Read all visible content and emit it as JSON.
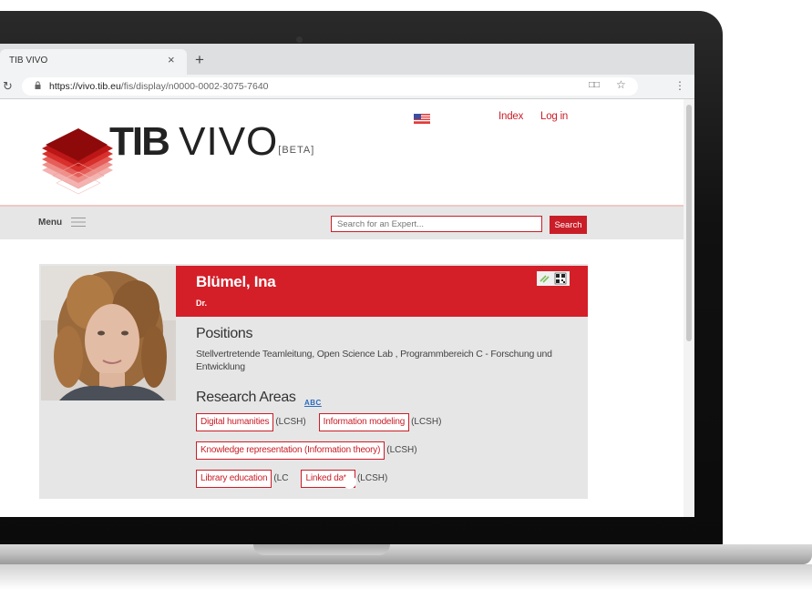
{
  "browser": {
    "tab_title": "TIB VIVO",
    "tab_close": "×",
    "new_tab": "+",
    "url_host": "https://vivo.tib.eu",
    "url_path": "/fis/display/n0000-0002-3075-7640",
    "reload_icon": "reload-icon",
    "star_icon": "star-icon"
  },
  "site": {
    "logo_bold": "TIB",
    "logo_thin": "VIVO",
    "logo_beta": "[BETA]",
    "language_flag": "us-flag",
    "links": {
      "index": "Index",
      "login": "Log in"
    },
    "menu_label": "Menu",
    "search_placeholder": "Search for an Expert...",
    "search_button": "Search",
    "accent_color": "#c91e28"
  },
  "profile": {
    "name": "Blümel, Ina",
    "title": "Dr.",
    "positions_heading": "Positions",
    "position": "Stellvertretende Teamleitung, Open Science Lab , Programmbereich C - Forschung und Entwicklung",
    "research_heading": "Research Areas",
    "research_icon_text": "ABC",
    "research_areas": [
      {
        "term": "Digital humanities",
        "vocab": "(LCSH)"
      },
      {
        "term": "Information modeling",
        "vocab": "(LCSH)"
      },
      {
        "term": "Knowledge representation (Information theory)",
        "vocab": "(LCSH)"
      },
      {
        "term": "Library education",
        "vocab": "(LC"
      },
      {
        "term": "Linked data",
        "vocab": "(LCSH)"
      }
    ]
  }
}
